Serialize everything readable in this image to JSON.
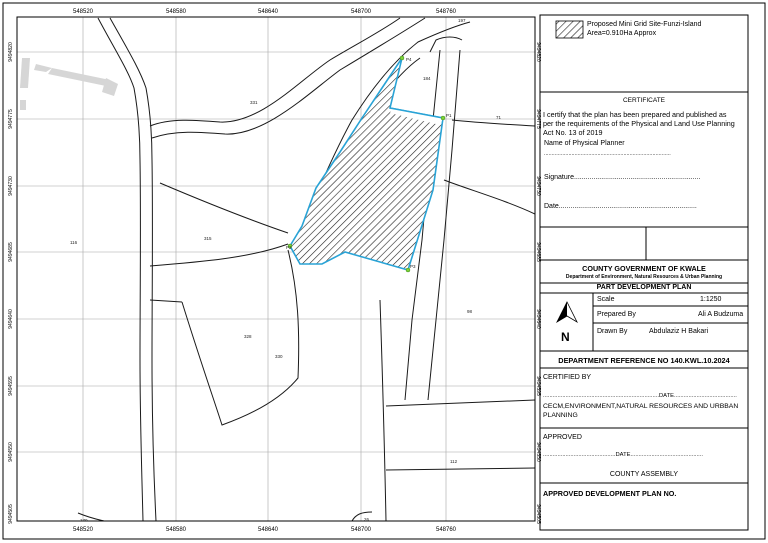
{
  "map": {
    "easting_labels_top": [
      "548520",
      "548580",
      "548640",
      "548700",
      "548760"
    ],
    "easting_labels_bottom": [
      "548520",
      "548580",
      "548640",
      "548700",
      "548760"
    ],
    "northing_labels_left": [
      "9494820",
      "9494775",
      "9494730",
      "9494685",
      "9494640",
      "9494595",
      "9494550",
      "9494505"
    ],
    "northing_labels_right": [
      "9494820",
      "9494775",
      "9494730",
      "9494685",
      "9494640",
      "9494595",
      "9494550",
      "9494505"
    ],
    "parcel_numbers": [
      "197",
      "184",
      "71",
      "331",
      "315",
      "116",
      "328",
      "330",
      "98",
      "112",
      "170",
      "26"
    ],
    "point_labels": [
      "P4",
      "P1",
      "P2",
      "P3"
    ],
    "colors": {
      "site_boundary": "#29a3d6",
      "grid": "#9a9a9a",
      "road_shadow": "#d8d8d8"
    }
  },
  "legend": {
    "line1": "Proposed Mini Grid Site-Funzi-Island",
    "line2": "Area=0.910Ha Approx"
  },
  "certificate": {
    "title": "CERTIFICATE",
    "line1": "I certify that the plan has been prepared and published as",
    "line2": "per the requirements of the Physical and Land Use Planning",
    "line3": "Act No. 13 of 2019",
    "name_label": "Name of Physical Planner",
    "dots": "...................................................................................",
    "signature": "Signature.................................................................",
    "date": "Date.......................................................................",
    "dots_short": "......................................................................................"
  },
  "government": {
    "county": "COUNTY GOVERNMENT OF KWALE",
    "department": "Department of Environment, Natural Resources & Urban Planning"
  },
  "plan": {
    "title": "PART DEVELOPMENT PLAN",
    "north": "N",
    "scale_label": "Scale",
    "scale_value": "1:1250",
    "prepared_label": "Prepared By",
    "prepared_value": "Ali A Budzuma",
    "drawn_label": "Drawn By",
    "drawn_value": "Abdulaziz H Bakari"
  },
  "reference": "DEPARTMENT REFERENCE NO 140.KWL.10.2024",
  "certified": {
    "title": "CERTIFIED BY",
    "date_line": "........................................................................DATE.......................................",
    "cecm": "CECM,ENVIRONMENT,NATURAL RESOURCES AND URBBAN",
    "planning": "PLANNING"
  },
  "approved": {
    "title": "APPROVED",
    "date_line": ".............................................DATE.............................................",
    "assembly": "COUNTY ASSEMBLY"
  },
  "approved_plan": "APPROVED DEVELOPMENT PLAN NO."
}
